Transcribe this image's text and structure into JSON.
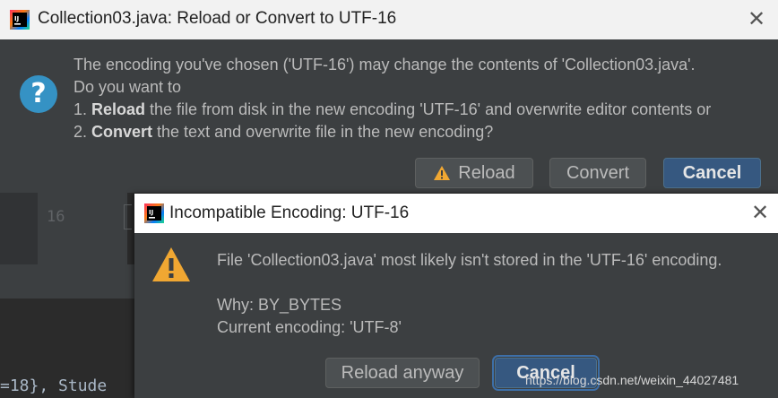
{
  "background": {
    "line_number": "16",
    "console_text": "=18}, Stude"
  },
  "dialog_reload": {
    "title": "Collection03.java: Reload or Convert to UTF-16",
    "message_line1": "The encoding you've chosen ('UTF-16') may change the contents of 'Collection03.java'.",
    "message_line2": "Do you want to",
    "option1_prefix": "1. ",
    "option1_bold": "Reload",
    "option1_rest": " the file from disk in the new encoding 'UTF-16' and overwrite editor contents or",
    "option2_prefix": "2. ",
    "option2_bold": "Convert",
    "option2_rest": " the text and overwrite file in the new encoding?",
    "buttons": {
      "reload": "Reload",
      "convert": "Convert",
      "cancel": "Cancel"
    },
    "icons": {
      "question": "question-icon",
      "warning": "warning-icon",
      "close": "close-icon",
      "logo": "intellij-logo"
    }
  },
  "dialog_incompatible": {
    "title": "Incompatible Encoding: UTF-16",
    "message_line1": "File 'Collection03.java' most likely isn't stored in the 'UTF-16' encoding.",
    "why_line": "Why: BY_BYTES",
    "current_encoding_line": "Current encoding: 'UTF-8'",
    "buttons": {
      "reload_anyway": "Reload anyway",
      "cancel": "Cancel"
    }
  },
  "watermark": "https://blog.csdn.net/weixin_44027481",
  "colors": {
    "dialog_bg": "#3c3f41",
    "primary_button": "#365880",
    "warning": "#f0a732",
    "question": "#3592c4"
  }
}
